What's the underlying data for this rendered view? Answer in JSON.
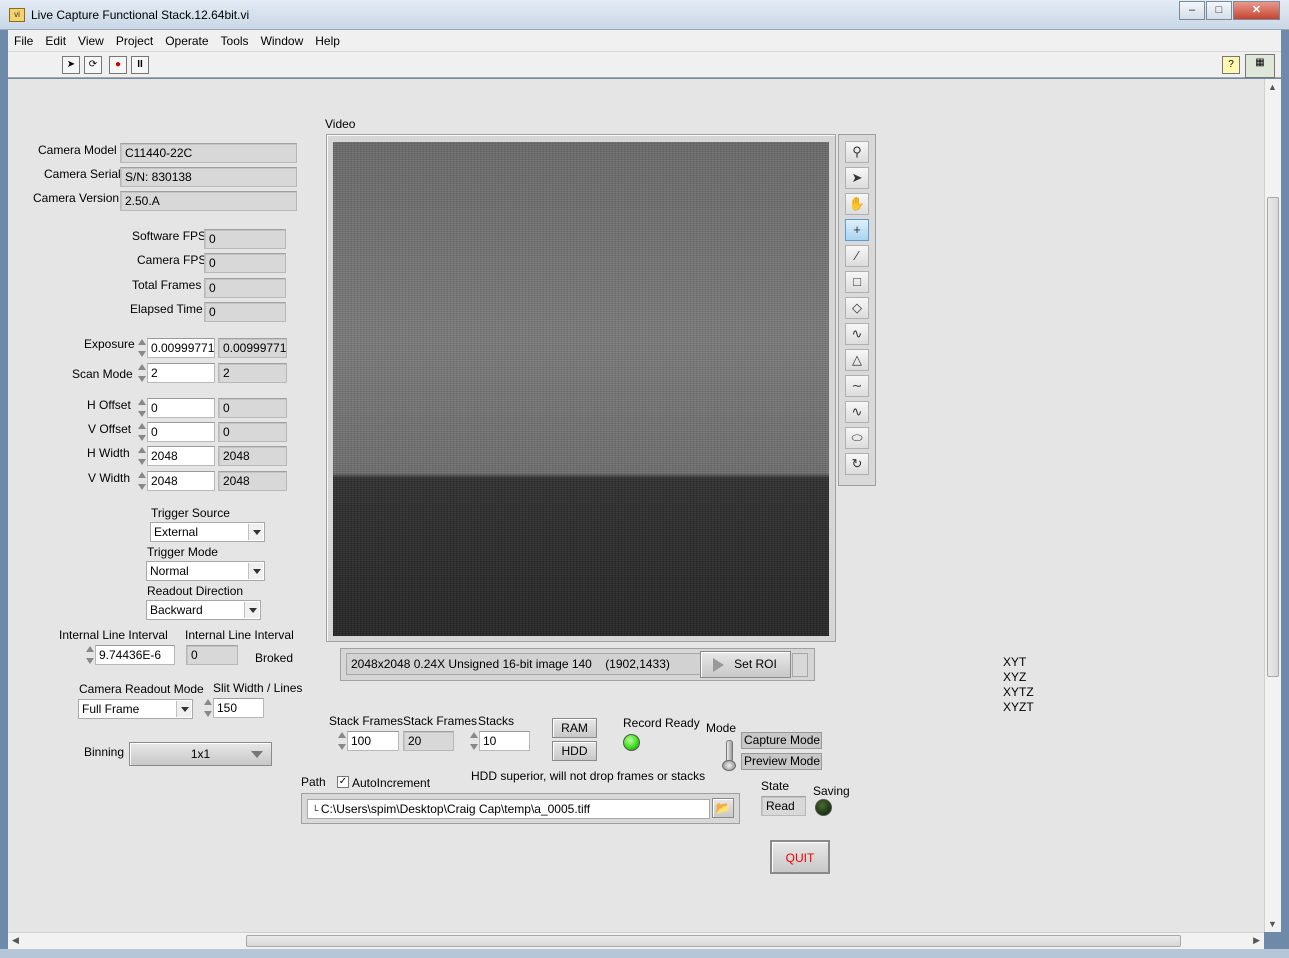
{
  "window": {
    "title": "Live Capture Functional Stack.12.64bit.vi",
    "min": "–",
    "max": "□",
    "close": "✕"
  },
  "menu": [
    "File",
    "Edit",
    "View",
    "Project",
    "Operate",
    "Tools",
    "Window",
    "Help"
  ],
  "camera": {
    "model_label": "Camera Model",
    "model": "C11440-22C",
    "serial_label": "Camera Serial",
    "serial": "S/N: 830138",
    "version_label": "Camera Version",
    "version": "2.50.A"
  },
  "stats": {
    "software_fps_label": "Software FPS",
    "software_fps": "0",
    "camera_fps_label": "Camera FPS",
    "camera_fps": "0",
    "total_frames_label": "Total Frames",
    "total_frames": "0",
    "elapsed_time_label": "Elapsed Time",
    "elapsed_time": "0"
  },
  "params": {
    "exposure_label": "Exposure",
    "exposure_set": "0.00999771",
    "exposure_actual": "0.00999771",
    "scan_mode_label": "Scan Mode",
    "scan_mode_set": "2",
    "scan_mode_actual": "2",
    "h_offset_label": "H Offset",
    "h_offset_set": "0",
    "h_offset_actual": "0",
    "v_offset_label": "V Offset",
    "v_offset_set": "0",
    "v_offset_actual": "0",
    "h_width_label": "H Width",
    "h_width_set": "2048",
    "h_width_actual": "2048",
    "v_width_label": "V Width",
    "v_width_set": "2048",
    "v_width_actual": "2048"
  },
  "trigger": {
    "source_label": "Trigger Source",
    "source": "External",
    "mode_label": "Trigger Mode",
    "mode": "Normal",
    "readout_label": "Readout Direction",
    "readout": "Backward"
  },
  "line_interval": {
    "label_set": "Internal Line Interval",
    "value_set": "9.74436E-6",
    "label_actual": "Internal Line Interval",
    "value_actual": "0",
    "broked": "Broked"
  },
  "readout_mode": {
    "label": "Camera Readout Mode",
    "value": "Full Frame",
    "slit_label": "Slit Width / Lines",
    "slit_value": "150"
  },
  "binning": {
    "label": "Binning",
    "value": "1x1"
  },
  "video": {
    "label": "Video",
    "status": "2048x2048 0.24X Unsigned 16-bit image 140",
    "coords": "(1902,1433)",
    "set_roi": "Set ROI"
  },
  "stack": {
    "frames_label": "Stack Frames",
    "frames_value": "100",
    "frames_actual_label": "Stack Frames",
    "frames_actual": "20",
    "stacks_label": "Stacks",
    "stacks_value": "10",
    "ram": "RAM",
    "hdd": "HDD",
    "record_ready_label": "Record Ready",
    "mode_label": "Mode",
    "capture_mode": "Capture Mode",
    "preview_mode": "Preview Mode",
    "hdd_note": "HDD superior, will not drop frames or stacks",
    "state_label": "State",
    "state_value": "Read",
    "saving_label": "Saving"
  },
  "path": {
    "label": "Path",
    "autoincrement": "AutoIncrement",
    "value": "C:\\Users\\spim\\Desktop\\Craig Cap\\temp\\a_0005.tiff"
  },
  "quit": "QUIT",
  "dims": [
    "XYT",
    "XYZ",
    "XYTZ",
    "XYZT"
  ],
  "colors": {
    "record_ready_led": "#3fdc1e",
    "saving_led": "#1f3a12",
    "quit_text": "#e00000"
  }
}
